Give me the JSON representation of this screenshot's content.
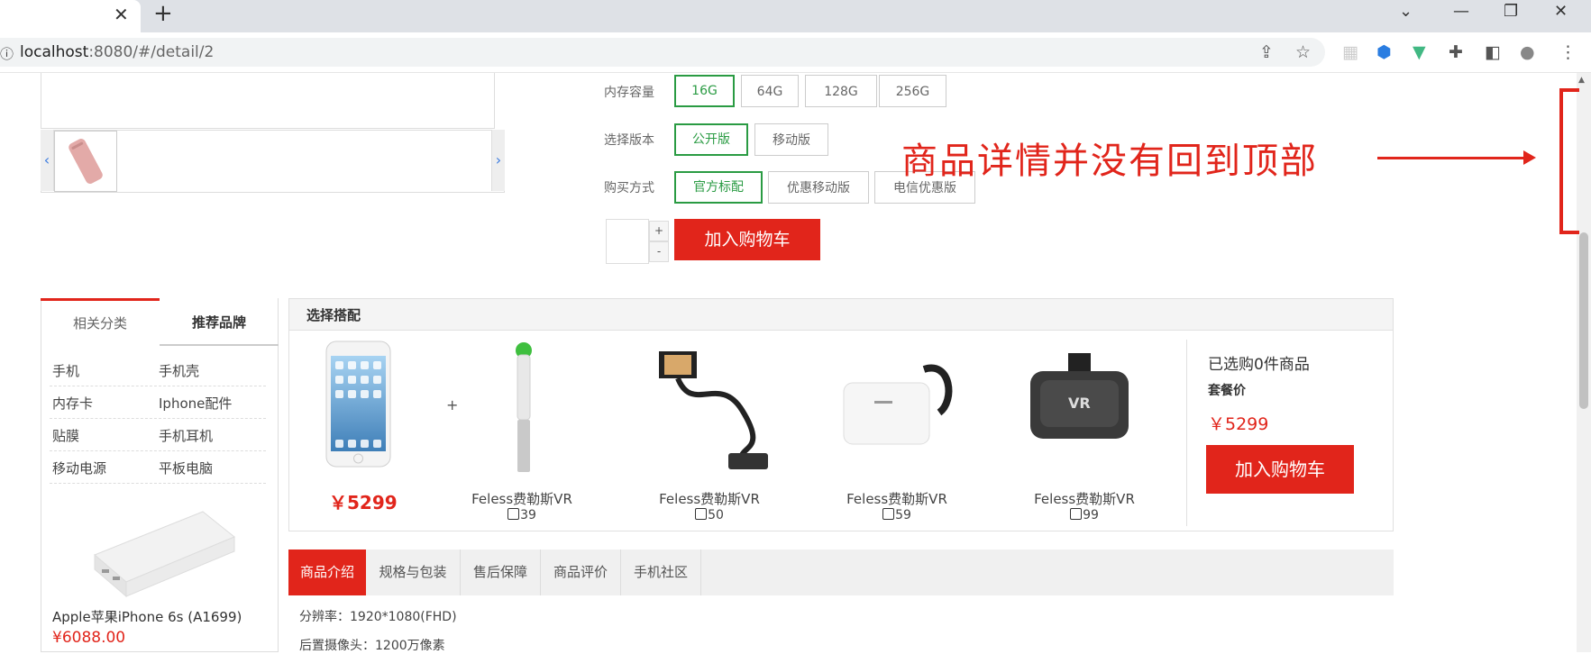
{
  "browser": {
    "url_host": "localhost",
    "url_rest": ":8080/#/detail/2",
    "new_tab": "+",
    "tab_close": "✕"
  },
  "options": {
    "memory": {
      "label": "内存容量",
      "choices": [
        "16G",
        "64G",
        "128G",
        "256G"
      ],
      "selected": "16G"
    },
    "version": {
      "label": "选择版本",
      "choices": [
        "公开版",
        "移动版"
      ],
      "selected": "公开版"
    },
    "purchase": {
      "label": "购买方式",
      "choices": [
        "官方标配",
        "优惠移动版",
        "电信优惠版"
      ],
      "selected": "官方标配"
    }
  },
  "quantity": {
    "value": "",
    "plus": "+",
    "minus": "-"
  },
  "add_to_cart": "加入购物车",
  "annotation": "商品详情并没有回到顶部",
  "sidebar": {
    "tabs": [
      "相关分类",
      "推荐品牌"
    ],
    "categories": [
      "手机",
      "手机壳",
      "内存卡",
      "Iphone配件",
      "贴膜",
      "手机耳机",
      "移动电源",
      "平板电脑"
    ],
    "product_name": "Apple苹果iPhone 6s (A1699)",
    "product_price": "¥6088.00"
  },
  "bundle": {
    "title": "选择搭配",
    "main_price": "￥5299",
    "plus": "+",
    "accessories": [
      {
        "name": "Feless费勒斯VR",
        "price": "39"
      },
      {
        "name": "Feless费勒斯VR",
        "price": "50"
      },
      {
        "name": "Feless费勒斯VR",
        "price": "59"
      },
      {
        "name": "Feless费勒斯VR",
        "price": "99"
      }
    ],
    "selected_count_text": "已选购0件商品",
    "combo_label": "套餐价",
    "combo_price": "￥5299",
    "add_button": "加入购物车"
  },
  "detail_tabs": [
    "商品介绍",
    "规格与包装",
    "售后保障",
    "商品评价",
    "手机社区"
  ],
  "specs": [
    "分辨率：1920*1080(FHD)",
    "后置摄像头：1200万像素"
  ],
  "colors": {
    "accent_red": "#e1251b",
    "selected_green": "#2a9b43"
  }
}
